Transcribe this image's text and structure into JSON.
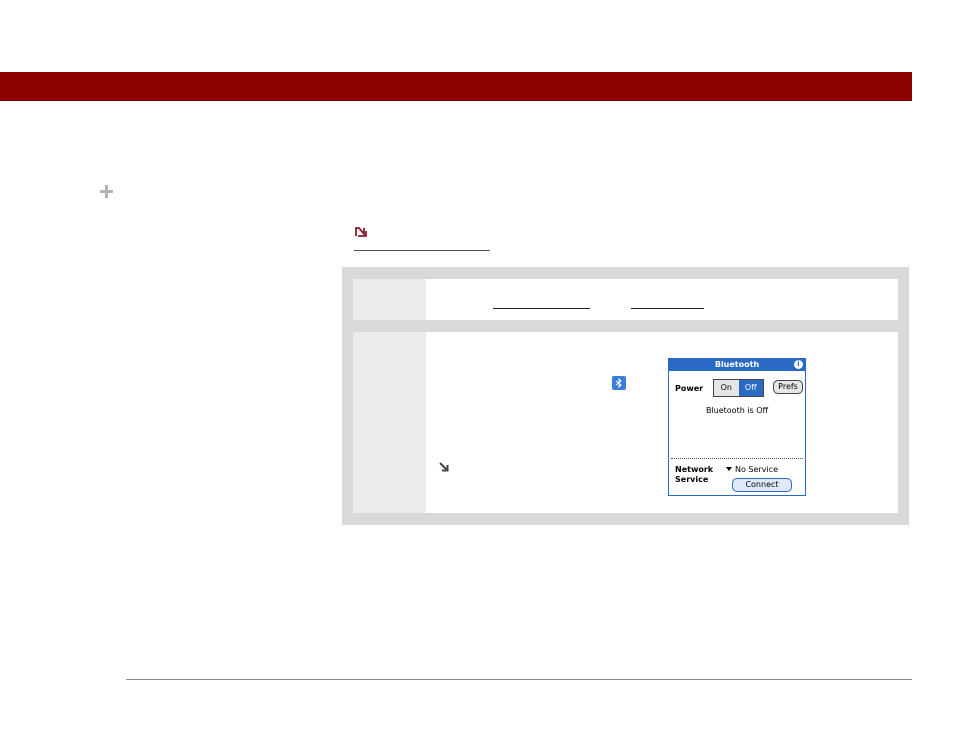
{
  "device_screen": {
    "title": "Bluetooth",
    "info_glyph": "i",
    "power_label": "Power",
    "power_on_label": "On",
    "power_off_label": "Off",
    "prefs_label": "Prefs",
    "status": "Bluetooth is Off",
    "network_label_line1": "Network",
    "network_label_line2": "Service",
    "service_value": "No Service",
    "connect_label": "Connect"
  },
  "colors": {
    "header_bar": "#8b0000",
    "device_accent": "#2a6ac4",
    "panel_bg": "#d9d9d9"
  },
  "icons": {
    "plus": "plus-icon",
    "note": "note-icon",
    "bluetooth": "bluetooth-icon",
    "arrow": "arrow-down-right-icon",
    "info": "info-icon"
  }
}
